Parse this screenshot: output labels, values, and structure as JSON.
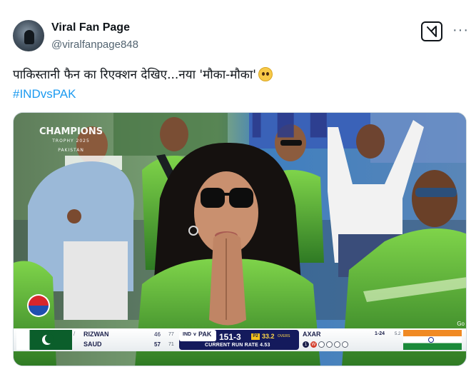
{
  "post": {
    "author_name": "Viral Fan Page",
    "author_handle": "@viralfanpage848",
    "text": "पाकिस्तानी फैन का रिएक्शन देखिए...नया 'मौका-मौका'",
    "hashtag": "#INDvsPAK",
    "icons": {
      "avatar": "profile-avatar",
      "grok": "grok-icon",
      "more": "more-options-icon",
      "emoji": "pleading-face-emoji"
    }
  },
  "media": {
    "event_logo": {
      "line1": "CHAMPIONS",
      "line2": "TROPHY 2025",
      "line3": "PAKISTAN"
    },
    "corner_mark": "Go"
  },
  "scoreboard": {
    "batters": [
      {
        "name": "RIZWAN",
        "runs": "46",
        "balls": "77"
      },
      {
        "name": "SAUD",
        "runs": "57",
        "balls": "71"
      }
    ],
    "team1": "IND",
    "vs": "v",
    "team2": "PAK",
    "score": "151-3",
    "powerplay": "P2",
    "overs": "33.2",
    "overs_label": "OVERS",
    "run_rate": "CURRENT RUN RATE 4.53",
    "bowler": {
      "name": "AXAR",
      "figures": "1-24",
      "overs": "5.2"
    },
    "wicket_ball": "W",
    "colors": {
      "pakistan_green": "#0b5e2b",
      "scoreboard_navy": "#141a5c",
      "accent_yellow": "#f5c21b",
      "link_blue": "#1d9bf0"
    }
  }
}
